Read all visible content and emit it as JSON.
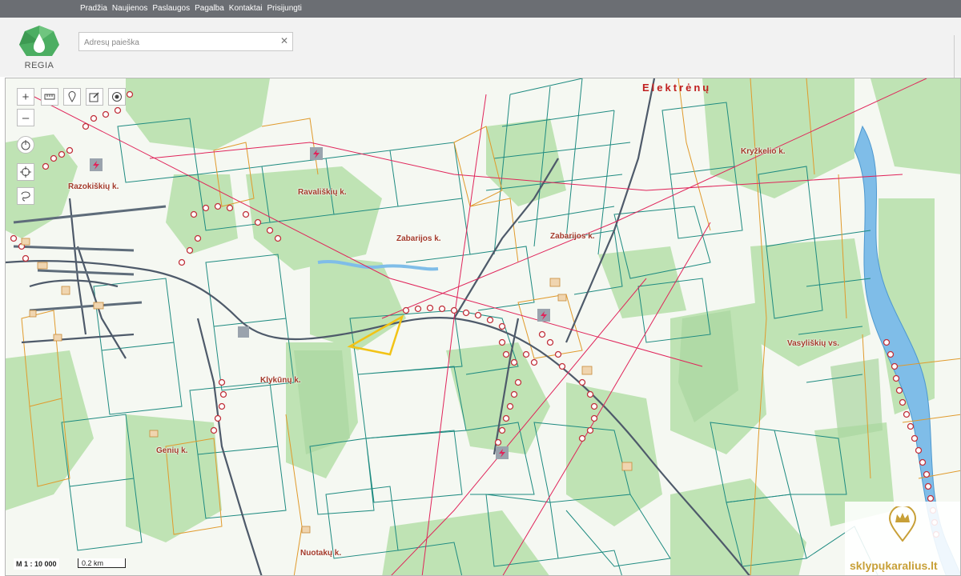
{
  "nav": {
    "items": [
      "Pradžia",
      "Naujienos",
      "Paslaugos",
      "Pagalba",
      "Kontaktai",
      "Prisijungti"
    ]
  },
  "logo": {
    "text": "REGIA",
    "color": "#4cae62"
  },
  "search": {
    "placeholder": "Adresų paieška",
    "value": ""
  },
  "map": {
    "town_label": "Elektrėnų",
    "places": [
      "Razokiškių k.",
      "Ravališkių k.",
      "Zabarijos k.",
      "Zabarijos k.",
      "Kryžkelio k.",
      "Klykūnų k.",
      "Vasyliškių vs.",
      "Genių k.",
      "Nuotakų k."
    ],
    "tools": [
      "zoom-in",
      "zoom-out",
      "measure",
      "marker",
      "edit",
      "location",
      "home",
      "crosshair",
      "draw-polygon"
    ]
  },
  "scale": {
    "ratio": "M 1 : 10 000",
    "bar": "0.2 km"
  },
  "brand": {
    "text": "sklypųkaralius.lt",
    "color": "#c8a038"
  },
  "colors": {
    "parcel_teal": "#1d8a80",
    "parcel_orange": "#e09a2c",
    "forest": "#bfe3b4",
    "water": "#7fbde8",
    "road_dark": "#4e5a6a",
    "power_line": "#e0245a"
  }
}
